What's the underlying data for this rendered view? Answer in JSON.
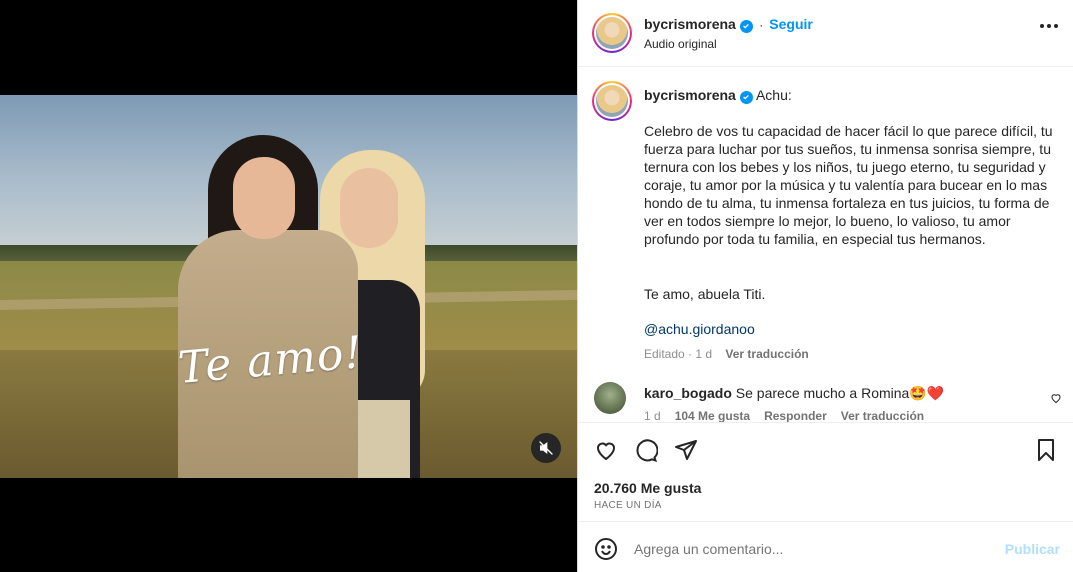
{
  "post": {
    "username": "bycrismorena",
    "follow_label": "Seguir",
    "audio_label": "Audio original",
    "overlay_text": "Te amo!",
    "caption": {
      "greeting": "Achu:",
      "paragraph": "Celebro de vos tu capacidad de hacer fácil lo que parece difícil, tu fuerza para luchar por tus sueños, tu inmensa sonrisa siempre, tu ternura con los bebes y los niños, tu juego eterno, tu seguridad y coraje, tu amor por la música y tu valentía para bucear en lo mas hondo de tu alma, tu inmensa fortaleza en tus juicios, tu forma de ver en todos siempre lo mejor, lo bueno, lo valioso, tu amor profundo por toda tu familia, en especial tus hermanos.",
      "signature": "Te amo, abuela Titi.",
      "mention": "@achu.giordanoo",
      "edited": "Editado · 1 d",
      "see_translation": "Ver traducción"
    },
    "comment": {
      "username": "karo_bogado",
      "text": "Se parece mucho a Romina🤩❤️",
      "time": "1 d",
      "likes": "104 Me gusta",
      "reply": "Responder",
      "see_translation": "Ver traducción"
    },
    "likes_count": "20.760 Me gusta",
    "time_ago": "HACE UN DÍA",
    "add_comment_placeholder": "Agrega un comentario...",
    "publish_label": "Publicar"
  },
  "colors": {
    "accent": "#0095f6",
    "text": "#262626",
    "muted": "#8e8e8e"
  }
}
